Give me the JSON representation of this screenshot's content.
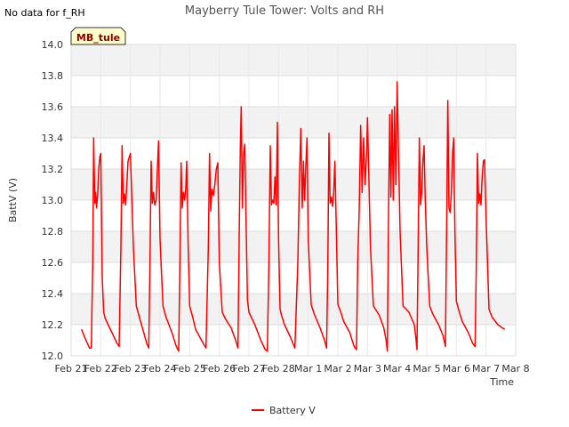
{
  "no_data_message": "No data for f_RH",
  "station_badge": "MB_tule",
  "chart_data": {
    "type": "line",
    "title": "Mayberry Tule Tower: Volts and RH",
    "xlabel": "Time",
    "ylabel": "BattV (V)",
    "ylim": [
      12.0,
      14.0
    ],
    "y_ticks": [
      "12.0",
      "12.2",
      "12.4",
      "12.6",
      "12.8",
      "13.0",
      "13.2",
      "13.4",
      "13.6",
      "13.8",
      "14.0"
    ],
    "x_ticks": [
      "Feb 21",
      "Feb 22",
      "Feb 23",
      "Feb 24",
      "Feb 25",
      "Feb 26",
      "Feb 27",
      "Feb 28",
      "Mar 1",
      "Mar 2",
      "Mar 3",
      "Mar 4",
      "Mar 5",
      "Mar 6",
      "Mar 7",
      "Mar 8"
    ],
    "grid": true,
    "legend_position": "bottom-center",
    "series": [
      {
        "name": "Battery V",
        "color": "#ff0000",
        "x_days": [
          0.35,
          0.5,
          0.62,
          0.68,
          0.73,
          0.76,
          0.8,
          0.83,
          0.86,
          0.9,
          0.93,
          0.97,
          1.0,
          1.05,
          1.1,
          1.15,
          1.25,
          1.4,
          1.55,
          1.62,
          1.68,
          1.72,
          1.76,
          1.8,
          1.84,
          1.88,
          1.92,
          2.0,
          2.1,
          2.2,
          2.3,
          2.45,
          2.55,
          2.62,
          2.66,
          2.7,
          2.74,
          2.78,
          2.82,
          2.87,
          2.91,
          2.95,
          3.0,
          3.1,
          3.2,
          3.4,
          3.55,
          3.63,
          3.67,
          3.71,
          3.75,
          3.79,
          3.83,
          3.87,
          3.9,
          3.95,
          4.0,
          4.1,
          4.2,
          4.4,
          4.55,
          4.63,
          4.67,
          4.71,
          4.75,
          4.8,
          4.85,
          4.9,
          4.95,
          5.0,
          5.1,
          5.2,
          5.4,
          5.55,
          5.63,
          5.67,
          5.71,
          5.74,
          5.78,
          5.82,
          5.86,
          5.9,
          5.95,
          6.0,
          6.1,
          6.2,
          6.4,
          6.55,
          6.62,
          6.67,
          6.72,
          6.76,
          6.8,
          6.84,
          6.88,
          6.92,
          6.96,
          7.0,
          7.05,
          7.1,
          7.2,
          7.4,
          7.55,
          7.65,
          7.7,
          7.75,
          7.8,
          7.84,
          7.88,
          7.92,
          7.96,
          8.0,
          8.1,
          8.2,
          8.4,
          8.55,
          8.62,
          8.66,
          8.7,
          8.74,
          8.78,
          8.82,
          8.86,
          8.9,
          8.95,
          9.0,
          9.1,
          9.2,
          9.4,
          9.55,
          9.63,
          9.67,
          9.72,
          9.77,
          9.82,
          9.87,
          9.92,
          9.97,
          10.0,
          10.1,
          10.2,
          10.4,
          10.55,
          10.63,
          10.67,
          10.71,
          10.75,
          10.79,
          10.83,
          10.87,
          10.91,
          10.96,
          11.0,
          11.1,
          11.2,
          11.4,
          11.58,
          11.63,
          11.67,
          11.71,
          11.75,
          11.79,
          11.83,
          11.87,
          11.91,
          11.95,
          12.0,
          12.1,
          12.2,
          12.4,
          12.55,
          12.63,
          12.67,
          12.71,
          12.75,
          12.79,
          12.83,
          12.87,
          12.91,
          12.95,
          13.0,
          13.1,
          13.2,
          13.4,
          13.55,
          13.63,
          13.67,
          13.71,
          13.75,
          13.79,
          13.83,
          13.87,
          13.91,
          13.95,
          14.0,
          14.1,
          14.2,
          14.4,
          14.55,
          14.63,
          14.67,
          14.71,
          14.75,
          14.79,
          14.83,
          14.87,
          14.91,
          14.95,
          15.0,
          15.05,
          15.12,
          15.18
        ],
        "values": [
          12.17,
          12.1,
          12.05,
          12.05,
          12.6,
          13.4,
          12.98,
          13.05,
          12.95,
          13.05,
          13.2,
          13.28,
          13.3,
          12.5,
          12.28,
          12.24,
          12.2,
          12.14,
          12.08,
          12.06,
          12.7,
          13.35,
          12.98,
          13.04,
          12.97,
          13.1,
          13.25,
          13.3,
          12.7,
          12.32,
          12.25,
          12.15,
          12.08,
          12.05,
          12.6,
          13.25,
          12.98,
          13.05,
          12.97,
          13.0,
          13.2,
          13.38,
          12.75,
          12.32,
          12.25,
          12.15,
          12.06,
          12.03,
          12.6,
          13.24,
          12.95,
          13.05,
          13.0,
          13.08,
          13.25,
          12.7,
          12.32,
          12.25,
          12.17,
          12.1,
          12.05,
          12.7,
          13.3,
          12.93,
          13.07,
          13.03,
          13.1,
          13.2,
          13.24,
          12.6,
          12.28,
          12.24,
          12.18,
          12.1,
          12.05,
          12.75,
          13.35,
          13.6,
          12.95,
          13.3,
          13.36,
          12.9,
          12.36,
          12.28,
          12.24,
          12.2,
          12.1,
          12.04,
          12.03,
          12.55,
          13.35,
          12.97,
          13.0,
          12.98,
          13.15,
          12.97,
          13.5,
          12.75,
          12.3,
          12.26,
          12.2,
          12.12,
          12.05,
          12.6,
          13.1,
          13.46,
          12.95,
          13.25,
          13.0,
          13.22,
          13.4,
          12.75,
          12.33,
          12.27,
          12.18,
          12.1,
          12.05,
          12.55,
          13.43,
          12.98,
          13.02,
          12.96,
          13.05,
          13.25,
          12.8,
          12.33,
          12.28,
          12.22,
          12.15,
          12.06,
          12.04,
          12.6,
          12.93,
          13.48,
          13.05,
          13.4,
          13.1,
          13.3,
          13.53,
          12.7,
          12.32,
          12.26,
          12.18,
          12.1,
          12.03,
          12.9,
          13.55,
          13.02,
          13.58,
          13.0,
          13.6,
          13.1,
          13.76,
          12.8,
          12.32,
          12.28,
          12.2,
          12.12,
          12.04,
          12.7,
          13.4,
          12.97,
          13.05,
          13.25,
          13.35,
          13.0,
          12.7,
          12.32,
          12.27,
          12.2,
          12.13,
          12.06,
          12.8,
          13.64,
          12.95,
          12.92,
          13.05,
          13.3,
          13.4,
          12.8,
          12.35,
          12.28,
          12.22,
          12.15,
          12.08,
          12.06,
          12.55,
          13.3,
          12.98,
          13.04,
          12.97,
          13.15,
          13.25,
          13.26,
          12.9,
          12.3,
          12.25,
          12.2,
          12.18,
          12.17
        ]
      }
    ]
  }
}
